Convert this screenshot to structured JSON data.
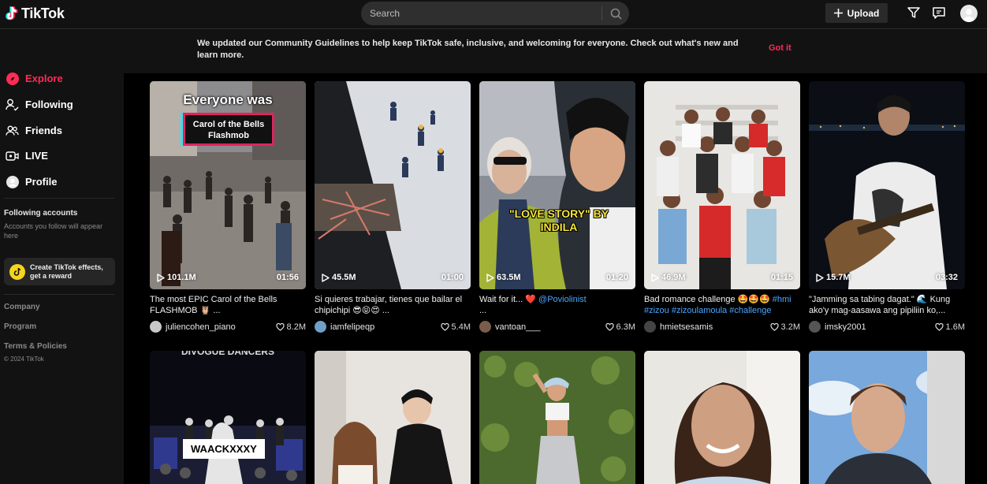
{
  "app": {
    "name": "TikTok"
  },
  "header": {
    "search_placeholder": "Search",
    "upload_label": "Upload"
  },
  "sidebar": {
    "nav": [
      {
        "label": "Explore",
        "icon": "compass-icon",
        "active": true
      },
      {
        "label": "Following",
        "icon": "user-follow-icon"
      },
      {
        "label": "Friends",
        "icon": "friends-icon"
      },
      {
        "label": "LIVE",
        "icon": "live-icon"
      },
      {
        "label": "Profile",
        "icon": "profile-icon"
      }
    ],
    "following_title": "Following accounts",
    "following_desc": "Accounts you follow will appear here",
    "effects_label": "Create TikTok effects, get a reward",
    "footer": [
      "Company",
      "Program",
      "Terms & Policies"
    ],
    "copyright": "© 2024 TikTok"
  },
  "banner": {
    "text": "We updated our Community Guidelines to help keep TikTok safe, inclusive, and welcoming for everyone. Check out what's new and learn more.",
    "button": "Got it"
  },
  "videos": [
    {
      "views": "101.1M",
      "duration": "01:56",
      "caption": "The most EPIC Carol of the Bells FLASHMOB 🦉 ...",
      "user": "juliencohen_piano",
      "likes": "8.2M",
      "overlay": "Everyone was",
      "overlay2": "Carol of the Bells Flashmob"
    },
    {
      "views": "45.5M",
      "duration": "01:00",
      "caption": "Si quieres trabajar, tienes que bailar el chipichipi 😎😝😍 ...",
      "user": "iamfelipeqp",
      "likes": "5.4M"
    },
    {
      "views": "63.5M",
      "duration": "01:20",
      "caption_pre": "Wait for it... ❤️ ",
      "caption_tag": "@Poviolinist",
      "caption_post": " ...",
      "user": "vantoan___",
      "likes": "6.3M",
      "overlay": "\"LOVE STORY\" BY INDILA"
    },
    {
      "views": "46.9M",
      "duration": "01:15",
      "caption_pre": "Bad romance challenge 🤩🤩🤩 ",
      "caption_tag": "#hmi #zizou #zizoulamoula #challenge",
      "caption_post": "",
      "user": "hmietsesamis",
      "likes": "3.2M"
    },
    {
      "views": "15.7M",
      "duration": "03:32",
      "caption_pre": "\"Jamming sa tabing dagat.\" 🌊 Kung ako'y mag-aasawa ang pipiliin ko,...",
      "caption_tag": "",
      "caption_post": "",
      "user": "imsky2001",
      "likes": "1.6M"
    }
  ],
  "row2_overlay": "WAACKXXXY",
  "row2_overlay_top": "DIVOGUE DANCERS"
}
